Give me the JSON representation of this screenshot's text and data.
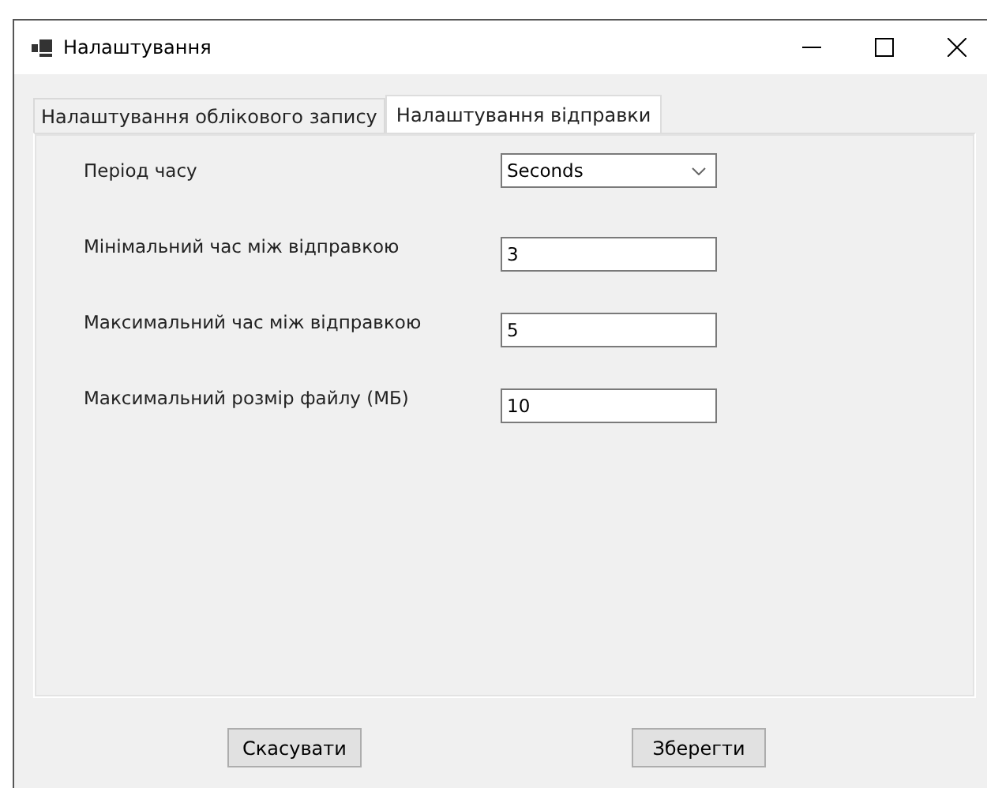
{
  "window": {
    "title": "Налаштування"
  },
  "tabs": [
    {
      "label": "Налаштування облікового запису",
      "selected": false
    },
    {
      "label": "Налаштування відправки",
      "selected": true
    }
  ],
  "fields": [
    {
      "kind": "dropdown",
      "label": "Період часу",
      "value": "Seconds"
    },
    {
      "kind": "text",
      "label": "Мінімальний час між відправкою",
      "value": "3"
    },
    {
      "kind": "text",
      "label": "Максимальний час між відправкою",
      "value": "5"
    },
    {
      "kind": "text",
      "label": "Максимальний розмір файлу (МБ)",
      "value": "10"
    }
  ],
  "buttons": [
    "Скасувати",
    "Зберегти"
  ]
}
